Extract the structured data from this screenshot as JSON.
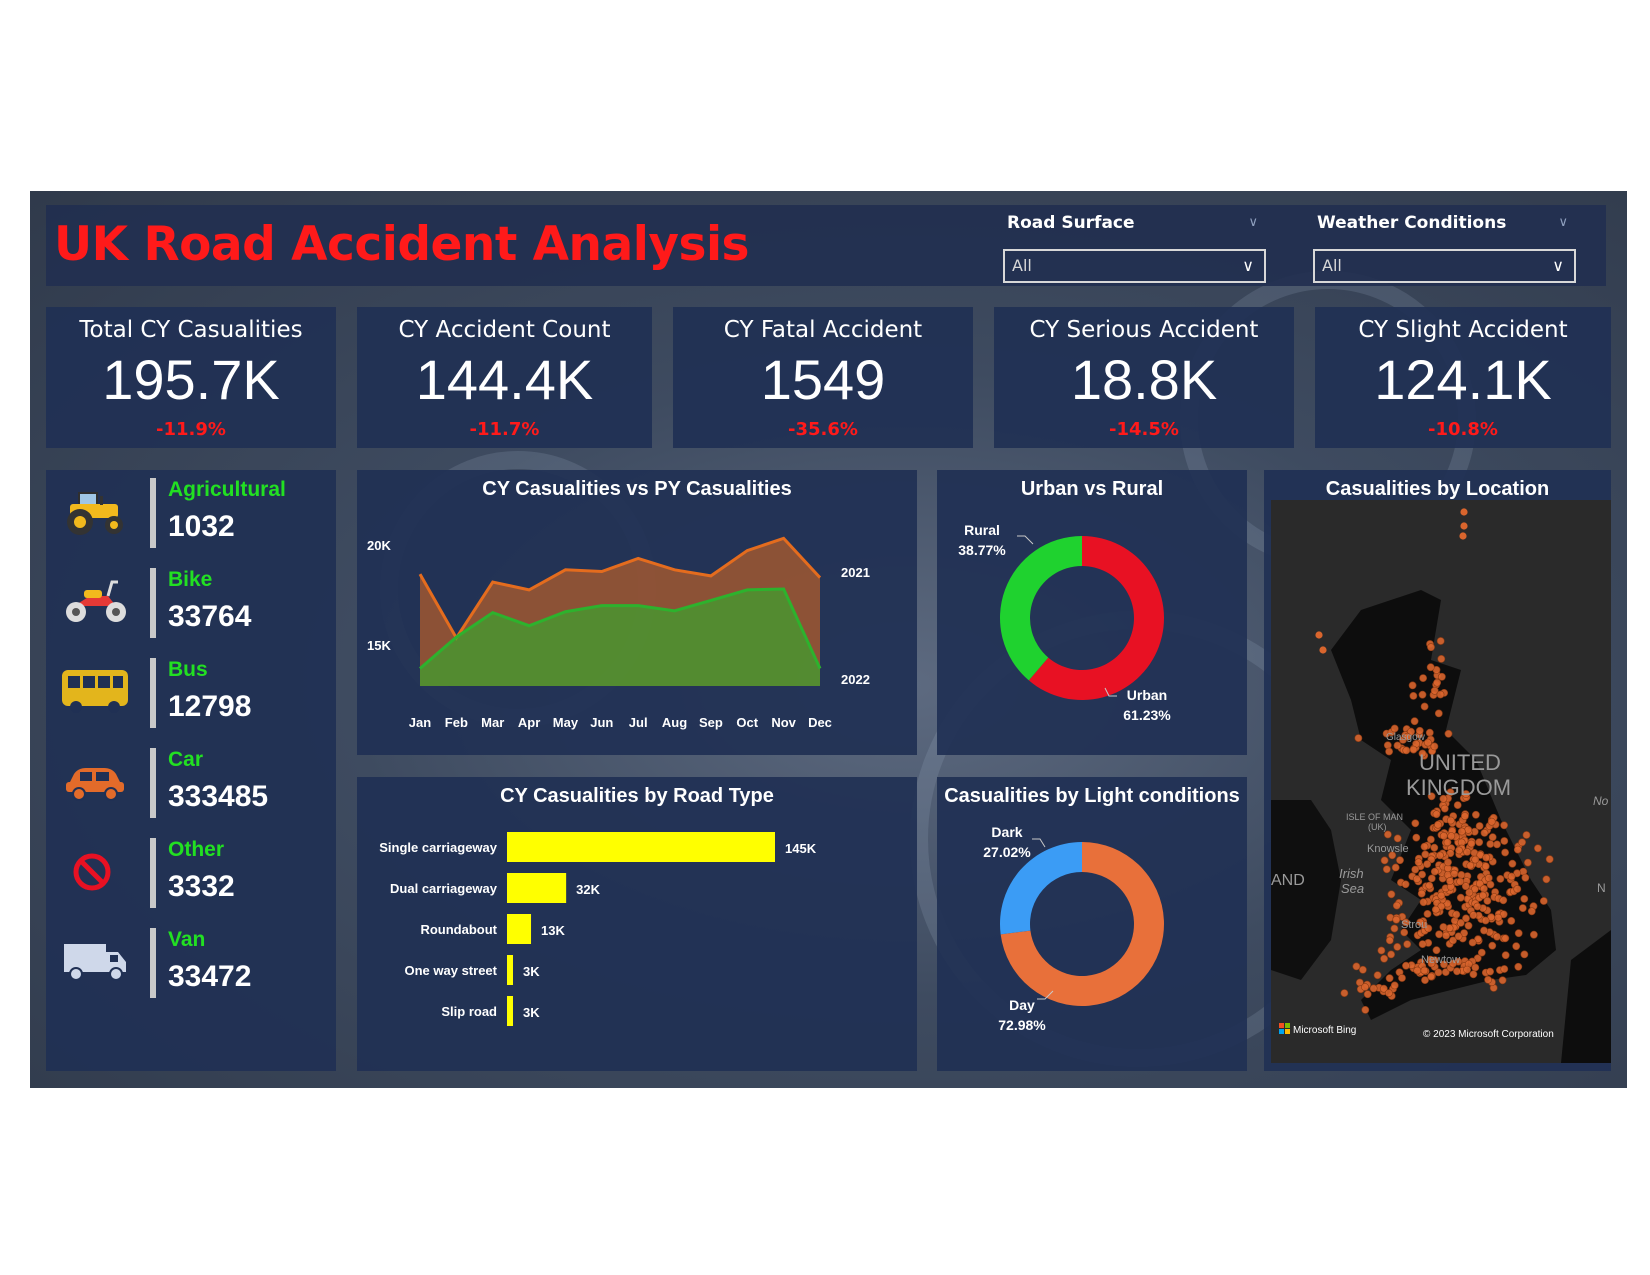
{
  "title": "UK Road Accident Analysis",
  "filters": {
    "road_surface": {
      "label": "Road Surface",
      "value": "All"
    },
    "weather": {
      "label": "Weather Conditions",
      "value": "All"
    }
  },
  "kpis": [
    {
      "label": "Total CY Casualities",
      "value": "195.7K",
      "change": "-11.9%"
    },
    {
      "label": "CY Accident Count",
      "value": "144.4K",
      "change": "-11.7%"
    },
    {
      "label": "CY Fatal Accident",
      "value": "1549",
      "change": "-35.6%"
    },
    {
      "label": "CY Serious Accident",
      "value": "18.8K",
      "change": "-14.5%"
    },
    {
      "label": "CY Slight Accident",
      "value": "124.1K",
      "change": "-10.8%"
    }
  ],
  "vehicles": [
    {
      "name": "Agricultural",
      "value": "1032",
      "icon": "tractor-icon"
    },
    {
      "name": "Bike",
      "value": "33764",
      "icon": "motorbike-icon"
    },
    {
      "name": "Bus",
      "value": "12798",
      "icon": "bus-icon"
    },
    {
      "name": "Car",
      "value": "333485",
      "icon": "car-icon"
    },
    {
      "name": "Other",
      "value": "3332",
      "icon": "prohibited-icon"
    },
    {
      "name": "Van",
      "value": "33472",
      "icon": "van-icon"
    }
  ],
  "colors": {
    "accent_red": "#ff1a1a",
    "green_label": "#22e022",
    "panel": "#203054"
  },
  "chart_data": [
    {
      "type": "area",
      "title": "CY Casualities vs PY Casualities",
      "categories": [
        "Jan",
        "Feb",
        "Mar",
        "Apr",
        "May",
        "Jun",
        "Jul",
        "Aug",
        "Sep",
        "Oct",
        "Nov",
        "Dec"
      ],
      "ytick_labels": [
        "20K",
        "15K"
      ],
      "ylim": [
        12000,
        21500
      ],
      "series": [
        {
          "name": "2021",
          "color": "#e46c1e",
          "values": [
            18400,
            14750,
            17950,
            17500,
            18650,
            18550,
            19300,
            18650,
            18300,
            19750,
            20450,
            18200
          ]
        },
        {
          "name": "2022",
          "color": "#2db22d",
          "values": [
            13000,
            14800,
            16200,
            15450,
            16250,
            16600,
            16600,
            16300,
            16900,
            17500,
            17550,
            13000
          ]
        }
      ]
    },
    {
      "type": "pie",
      "title": "Urban vs Rural",
      "labels": [
        "Urban",
        "Rural"
      ],
      "values": [
        61.23,
        38.77
      ],
      "display": [
        "61.23%",
        "38.77%"
      ],
      "colors": [
        "#e81123",
        "#1fd22f"
      ]
    },
    {
      "type": "bar",
      "title": "CY Casualities by Road Type",
      "categories": [
        "Single carriageway",
        "Dual carriageway",
        "Roundabout",
        "One way street",
        "Slip road"
      ],
      "values": [
        145,
        32,
        13,
        3,
        3
      ],
      "data_labels": [
        "145K",
        "32K",
        "13K",
        "3K",
        "3K"
      ],
      "color": "#ffff00"
    },
    {
      "type": "pie",
      "title": "Casualities by Light conditions",
      "labels": [
        "Day",
        "Dark"
      ],
      "values": [
        72.98,
        27.02
      ],
      "display": [
        "72.98%",
        "27.02%"
      ],
      "colors": [
        "#e8703a",
        "#3b9cf5"
      ]
    }
  ],
  "map": {
    "title": "Casualities by Location",
    "labels": [
      "UNITED",
      "KINGDOM",
      "ISLE OF MAN",
      "(UK)",
      "Irish",
      "Sea",
      "Knowsle",
      "AND",
      "Glasgow",
      "Strou",
      "Newtow",
      "No",
      "N"
    ],
    "attribution_left": "Microsoft Bing",
    "attribution_right": "© 2023 Microsoft Corporation",
    "point_color": "#d9652d"
  }
}
